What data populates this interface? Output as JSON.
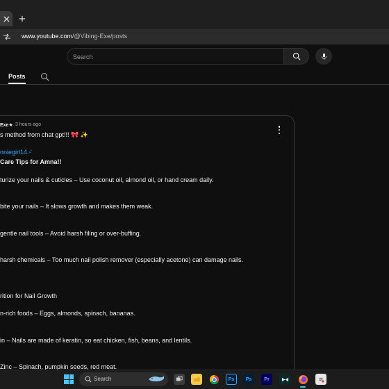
{
  "browser": {
    "tab_fragment": "o",
    "url_host": "www.youtube.com",
    "url_path": "/@Vibing-Exe/posts"
  },
  "header": {
    "search_placeholder": "Search"
  },
  "tabs": [
    {
      "label": "Posts",
      "active": true
    }
  ],
  "post": {
    "author": "Exe★",
    "time": "3 hours ago",
    "lines": [
      {
        "text": "s method from chat gpt!!! 🎀 ✨",
        "style": "normal"
      },
      {
        "text": "nniegirl14.ᵕ̈",
        "style": "link"
      },
      {
        "text": "Care Tips for Amna!!",
        "style": "bold"
      },
      {
        "text": "turize your nails & cuticles – Use coconut oil, almond oil, or hand cream daily.",
        "style": "normal"
      },
      {
        "text": "bite your nails – It slows growth and makes them weak.",
        "style": "normal"
      },
      {
        "text": "gentle nail tools – Avoid harsh filing or over-buffing.",
        "style": "normal"
      },
      {
        "text": "harsh chemicals – Too much nail polish remover (especially acetone) can damage nails.",
        "style": "normal"
      },
      {
        "text": "rition for Nail Growth",
        "style": "normal"
      },
      {
        "text": "n-rich foods – Eggs, almonds, spinach, bananas.",
        "style": "normal"
      },
      {
        "text": "in – Nails are made of keratin, so eat chicken, fish, beans, and lentils.",
        "style": "normal"
      },
      {
        "text": "Zinc – Spinach, pumpkin seeds, red meat.",
        "style": "normal"
      }
    ]
  },
  "taskbar": {
    "search_label": "Search",
    "apps": [
      "windows-start",
      "task-view",
      "file-explorer",
      "chrome",
      "photoshop",
      "photoshop",
      "premiere-pro",
      "capcut",
      "firefox",
      "notepad"
    ]
  },
  "colors": {
    "background": "#0f0f0f",
    "link": "#3ea6ff",
    "accent": "#4cc2ff"
  }
}
